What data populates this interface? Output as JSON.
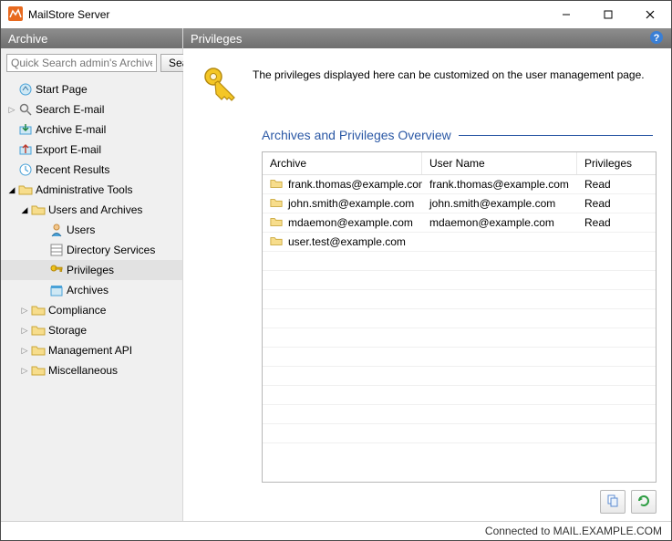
{
  "window": {
    "title": "MailStore Server"
  },
  "sidebar": {
    "title": "Archive",
    "search": {
      "placeholder": "Quick Search admin's Archive",
      "button": "Search"
    },
    "tree": [
      {
        "id": "start-page",
        "label": "Start Page"
      },
      {
        "id": "search-email",
        "label": "Search E-mail"
      },
      {
        "id": "archive-email",
        "label": "Archive E-mail"
      },
      {
        "id": "export-email",
        "label": "Export E-mail"
      },
      {
        "id": "recent-results",
        "label": "Recent Results"
      },
      {
        "id": "admin-tools",
        "label": "Administrative Tools"
      },
      {
        "id": "users-archives",
        "label": "Users and Archives"
      },
      {
        "id": "users",
        "label": "Users"
      },
      {
        "id": "directory",
        "label": "Directory Services"
      },
      {
        "id": "privileges",
        "label": "Privileges"
      },
      {
        "id": "archives",
        "label": "Archives"
      },
      {
        "id": "compliance",
        "label": "Compliance"
      },
      {
        "id": "storage",
        "label": "Storage"
      },
      {
        "id": "management-api",
        "label": "Management API"
      },
      {
        "id": "misc",
        "label": "Miscellaneous"
      }
    ]
  },
  "main": {
    "title": "Privileges",
    "intro": "The privileges displayed here can be customized on the user management page.",
    "section_title": "Archives and Privileges Overview",
    "columns": {
      "archive": "Archive",
      "user": "User Name",
      "priv": "Privileges"
    },
    "rows": [
      {
        "archive": "frank.thomas@example.com",
        "user": "frank.thomas@example.com",
        "priv": "Read"
      },
      {
        "archive": "john.smith@example.com",
        "user": "john.smith@example.com",
        "priv": "Read"
      },
      {
        "archive": "mdaemon@example.com",
        "user": "mdaemon@example.com",
        "priv": "Read"
      },
      {
        "archive": "user.test@example.com",
        "user": "",
        "priv": ""
      }
    ],
    "actions": {
      "copy": "copy-icon",
      "refresh": "refresh-icon"
    }
  },
  "status": {
    "text": "Connected to MAIL.EXAMPLE.COM"
  }
}
